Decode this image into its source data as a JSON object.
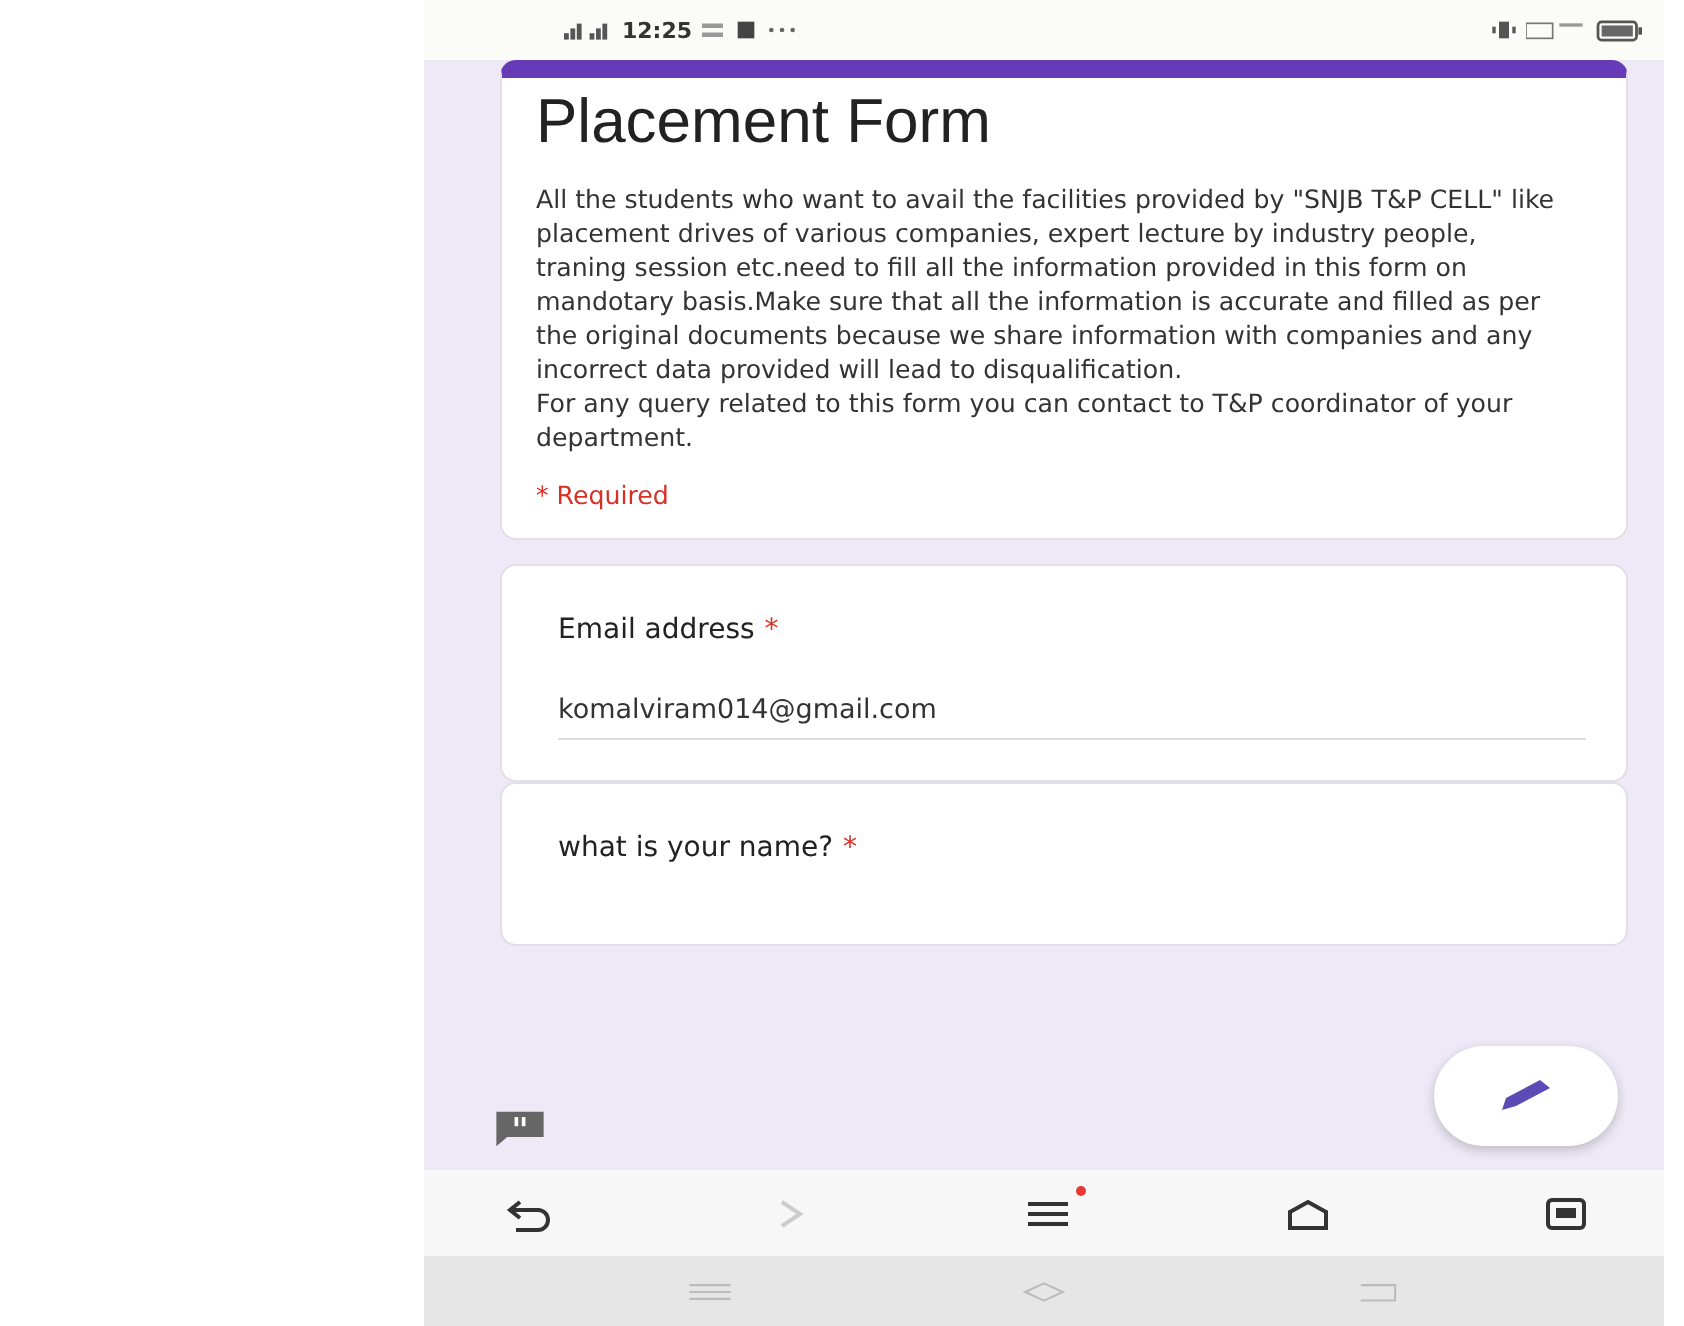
{
  "status_bar": {
    "time": "12:25"
  },
  "form": {
    "title": "Placement Form",
    "description": "All the students who want to avail the facilities provided by \"SNJB T&P CELL\" like placement drives of various companies, expert lecture by industry people, traning session etc.need to fill all the information provided in this form on mandotary basis.Make sure that all the information is accurate and filled as per the original documents because we share information with companies and any incorrect data provided will lead to disqualification.\nFor any query related to this form you can contact to T&P coordinator of your department.",
    "required_note": "* Required"
  },
  "questions": [
    {
      "label": "Email address",
      "required_mark": "*",
      "value": "komalviram014@gmail.com"
    },
    {
      "label": "what is your name?",
      "required_mark": "*"
    }
  ],
  "browser_toolbar": {
    "menu_badge": true
  }
}
